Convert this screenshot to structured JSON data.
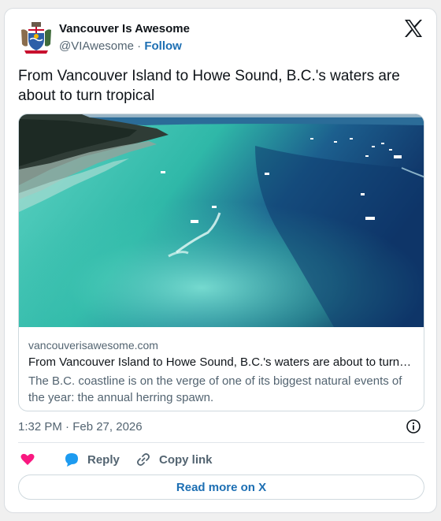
{
  "author": {
    "name": "Vancouver Is Awesome",
    "handle": "@VIAwesome",
    "separator": "·",
    "follow_label": "Follow"
  },
  "icons": {
    "avatar": "crest-logo",
    "platform": "x-logo",
    "info": "info-icon",
    "like": "heart-icon",
    "reply": "speech-bubble-icon",
    "copy": "link-icon"
  },
  "tweet": {
    "text": "From Vancouver Island to Howe Sound, B.C.'s waters are about to turn tropical"
  },
  "link_card": {
    "image_alt": "aerial-photo-turquoise-water",
    "domain": "vancouverisawesome.com",
    "title": "From Vancouver Island to Howe Sound, B.C.'s waters are about to turn…",
    "description": "The B.C. coastline is on the verge of one of its biggest natural events of the year: the annual herring spawn."
  },
  "meta": {
    "timestamp": "1:32 PM · Feb 27, 2026"
  },
  "actions": {
    "reply_label": "Reply",
    "copy_label": "Copy link"
  },
  "read_more_label": "Read more on X",
  "colors": {
    "accent": "#1d6fb3",
    "heart": "#f91880",
    "reply": "#1d9bf0",
    "muted": "#536471"
  }
}
